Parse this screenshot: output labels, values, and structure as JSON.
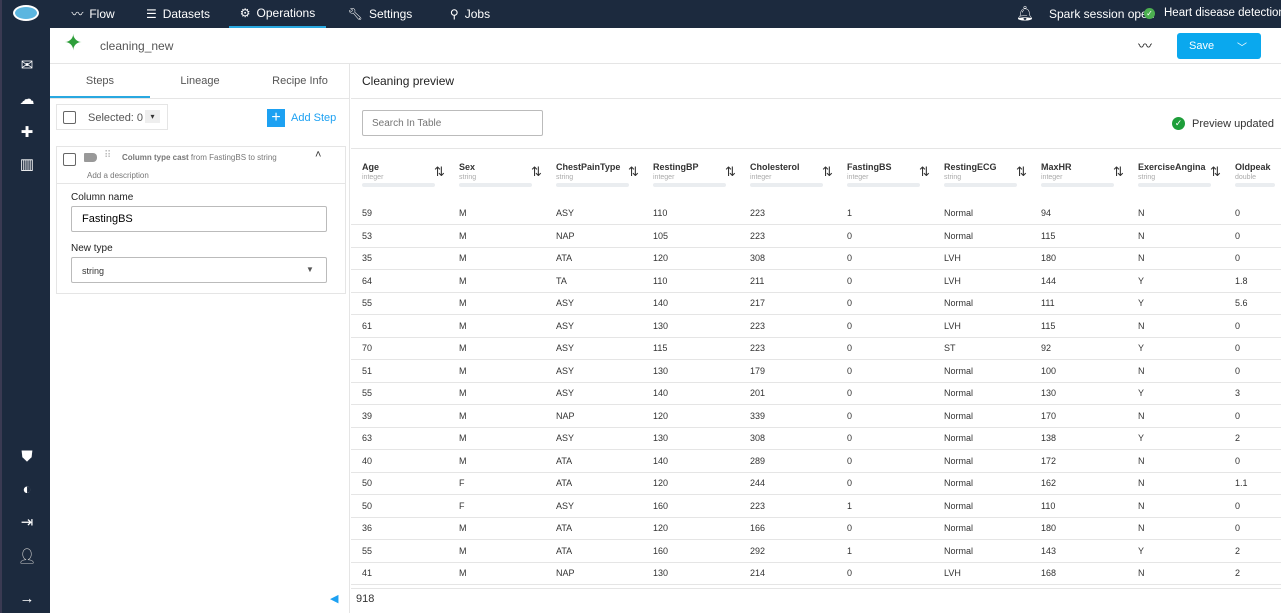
{
  "nav": {
    "items": [
      {
        "label": "Flow",
        "icon": "trend-icon"
      },
      {
        "label": "Datasets",
        "icon": "list-icon"
      },
      {
        "label": "Operations",
        "icon": "gear-icon"
      },
      {
        "label": "Settings",
        "icon": "wrench-icon"
      },
      {
        "label": "Jobs",
        "icon": "jobs-icon"
      }
    ],
    "active": "Operations",
    "session": "Spark session open",
    "project": "Heart disease detection"
  },
  "header": {
    "recipe_name": "cleaning_new",
    "save_label": "Save"
  },
  "left": {
    "tabs": [
      "Steps",
      "Lineage",
      "Recipe Info"
    ],
    "selected": "Selected: 0",
    "add_step": "Add Step",
    "step": {
      "title": "Column type cast",
      "detail": "from FastingBS to string",
      "description_placeholder": "Add a description",
      "column_label": "Column name",
      "column_value": "FastingBS",
      "type_label": "New type",
      "type_value": "string"
    }
  },
  "preview": {
    "title": "Cleaning preview",
    "search_placeholder": "Search In Table",
    "status": "Preview updated",
    "status_color": "#1e9e3a",
    "row_count": "918",
    "columns": [
      {
        "name": "Age",
        "type": "integer"
      },
      {
        "name": "Sex",
        "type": "string"
      },
      {
        "name": "ChestPainType",
        "type": "string"
      },
      {
        "name": "RestingBP",
        "type": "integer"
      },
      {
        "name": "Cholesterol",
        "type": "integer"
      },
      {
        "name": "FastingBS",
        "type": "integer"
      },
      {
        "name": "RestingECG",
        "type": "string"
      },
      {
        "name": "MaxHR",
        "type": "integer"
      },
      {
        "name": "ExerciseAngina",
        "type": "string"
      },
      {
        "name": "Oldpeak",
        "type": "double"
      }
    ],
    "rows": [
      [
        "59",
        "M",
        "ASY",
        "110",
        "223",
        "1",
        "Normal",
        "94",
        "N",
        "0"
      ],
      [
        "53",
        "M",
        "NAP",
        "105",
        "223",
        "0",
        "Normal",
        "115",
        "N",
        "0"
      ],
      [
        "35",
        "M",
        "ATA",
        "120",
        "308",
        "0",
        "LVH",
        "180",
        "N",
        "0"
      ],
      [
        "64",
        "M",
        "TA",
        "110",
        "211",
        "0",
        "LVH",
        "144",
        "Y",
        "1.8"
      ],
      [
        "55",
        "M",
        "ASY",
        "140",
        "217",
        "0",
        "Normal",
        "111",
        "Y",
        "5.6"
      ],
      [
        "61",
        "M",
        "ASY",
        "130",
        "223",
        "0",
        "LVH",
        "115",
        "N",
        "0"
      ],
      [
        "70",
        "M",
        "ASY",
        "115",
        "223",
        "0",
        "ST",
        "92",
        "Y",
        "0"
      ],
      [
        "51",
        "M",
        "ASY",
        "130",
        "179",
        "0",
        "Normal",
        "100",
        "N",
        "0"
      ],
      [
        "55",
        "M",
        "ASY",
        "140",
        "201",
        "0",
        "Normal",
        "130",
        "Y",
        "3"
      ],
      [
        "39",
        "M",
        "NAP",
        "120",
        "339",
        "0",
        "Normal",
        "170",
        "N",
        "0"
      ],
      [
        "63",
        "M",
        "ASY",
        "130",
        "308",
        "0",
        "Normal",
        "138",
        "Y",
        "2"
      ],
      [
        "40",
        "M",
        "ATA",
        "140",
        "289",
        "0",
        "Normal",
        "172",
        "N",
        "0"
      ],
      [
        "50",
        "F",
        "ATA",
        "120",
        "244",
        "0",
        "Normal",
        "162",
        "N",
        "1.1"
      ],
      [
        "50",
        "F",
        "ASY",
        "160",
        "223",
        "1",
        "Normal",
        "110",
        "N",
        "0"
      ],
      [
        "36",
        "M",
        "ATA",
        "120",
        "166",
        "0",
        "Normal",
        "180",
        "N",
        "0"
      ],
      [
        "55",
        "M",
        "ATA",
        "160",
        "292",
        "1",
        "Normal",
        "143",
        "Y",
        "2"
      ],
      [
        "41",
        "M",
        "NAP",
        "130",
        "214",
        "0",
        "LVH",
        "168",
        "N",
        "2"
      ]
    ]
  }
}
